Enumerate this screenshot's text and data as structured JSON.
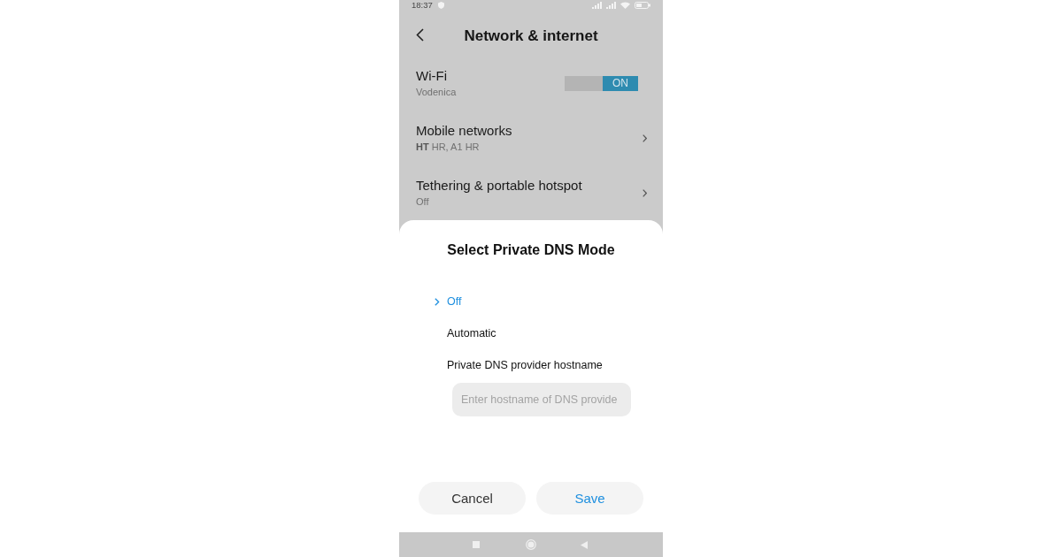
{
  "status_bar": {
    "time": "18:37"
  },
  "header": {
    "title": "Network & internet"
  },
  "settings": [
    {
      "kind": "toggle",
      "title": "Wi-Fi",
      "subtitle": "Vodenica",
      "on": true,
      "toggle_label": "ON"
    },
    {
      "kind": "link",
      "title": "Mobile networks",
      "subtitle": "**HT** HR, A1 HR"
    },
    {
      "kind": "link",
      "title": "Tethering & portable hotspot",
      "subtitle": "Off"
    }
  ],
  "dialog": {
    "title": "Select Private DNS Mode",
    "options": [
      {
        "label": "Off",
        "selected": true
      },
      {
        "label": "Automatic",
        "selected": false
      },
      {
        "label": "Private DNS provider hostname",
        "selected": false
      }
    ],
    "hostname_field": {
      "placeholder": "Enter hostname of DNS provide"
    },
    "buttons": [
      {
        "label": "Cancel",
        "kind": "secondary"
      },
      {
        "label": "Save",
        "kind": "primary"
      }
    ]
  }
}
